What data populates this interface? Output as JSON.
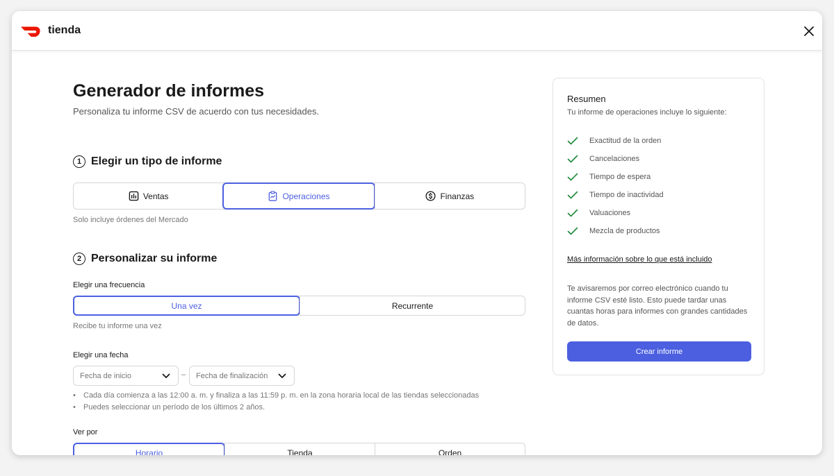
{
  "app": {
    "brand": "tienda",
    "brand_color": "#eb1700",
    "accent": "#4b5fe0"
  },
  "page": {
    "title": "Generador de informes",
    "subtitle": "Personaliza tu informe CSV de acuerdo con tus necesidades."
  },
  "step1": {
    "number": "1",
    "title": "Elegir un tipo de informe",
    "options": [
      {
        "label": "Ventas",
        "icon": "bar-chart-icon",
        "selected": false
      },
      {
        "label": "Operaciones",
        "icon": "clipboard-icon",
        "selected": true
      },
      {
        "label": "Finanzas",
        "icon": "dollar-circle-icon",
        "selected": false
      }
    ],
    "hint": "Solo incluye órdenes del Mercado"
  },
  "step2": {
    "number": "2",
    "title": "Personalizar su informe",
    "frequency": {
      "label": "Elegir una frecuencia",
      "options": [
        {
          "label": "Una vez",
          "selected": true
        },
        {
          "label": "Recurrente",
          "selected": false
        }
      ],
      "hint": "Recibe tu informe una vez"
    },
    "date": {
      "label": "Elegir una fecha",
      "start_placeholder": "Fecha de inicio",
      "end_placeholder": "Fecha de finalización",
      "separator": "–",
      "notes": [
        "Cada día comienza a las 12:00 a. m. y finaliza a las 11:59 p. m. en la zona horaria local de las tiendas seleccionadas",
        "Puedes seleccionar un período de los últimos 2 años."
      ]
    },
    "view_by": {
      "label": "Ver por",
      "options": [
        {
          "label": "Horario",
          "selected": true
        },
        {
          "label": "Tienda",
          "selected": false
        },
        {
          "label": "Orden",
          "selected": false
        }
      ]
    }
  },
  "summary": {
    "title": "Resumen",
    "subtitle": "Tu informe de operaciones incluye lo siguiente:",
    "items": [
      "Exactitud de la orden",
      "Cancelaciones",
      "Tiempo de espera",
      "Tiempo de inactividad",
      "Valuaciones",
      "Mezcla de productos"
    ],
    "more_link": "Más información sobre lo que está incluido",
    "note": "Te avisaremos por correo electrónico cuando tu informe CSV esté listo. Esto puede tardar unas cuantas horas para informes con grandes cantidades de datos.",
    "create_label": "Crear informe",
    "check_color": "#1f8a3a"
  }
}
